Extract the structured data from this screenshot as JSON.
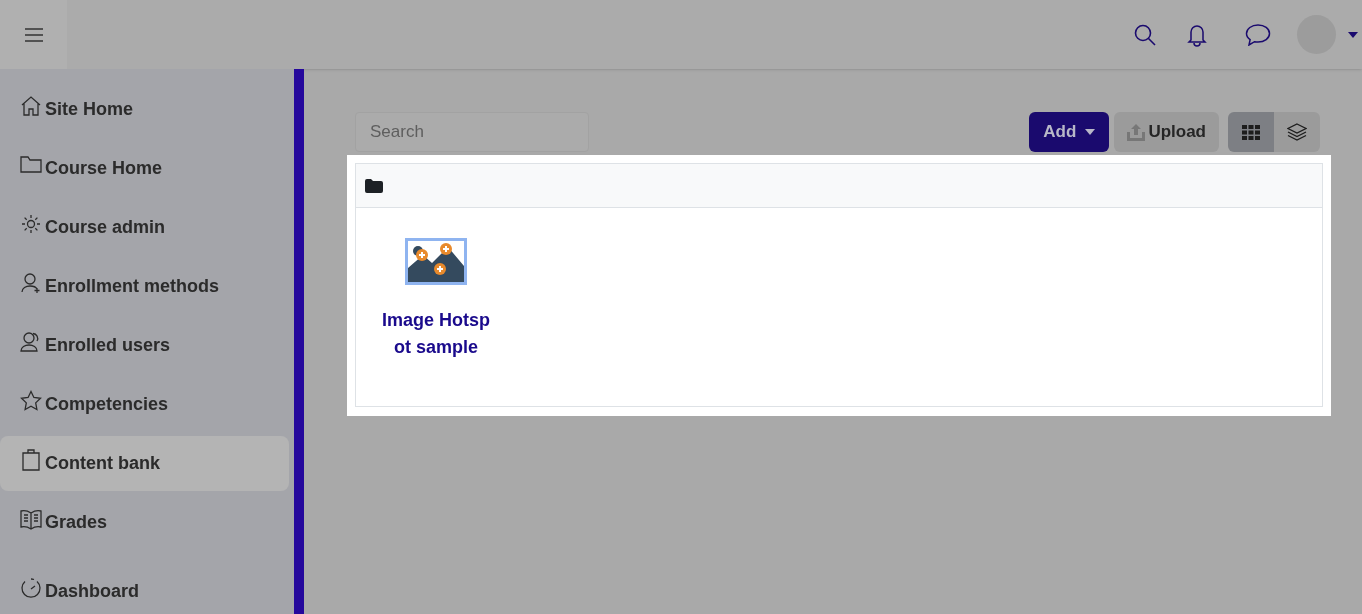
{
  "sidebar": {
    "items": [
      {
        "label": "Site Home",
        "selected": false
      },
      {
        "label": "Course Home",
        "selected": false
      },
      {
        "label": "Course admin",
        "selected": false
      },
      {
        "label": "Enrollment methods",
        "selected": false
      },
      {
        "label": "Enrolled users",
        "selected": false
      },
      {
        "label": "Competencies",
        "selected": false
      },
      {
        "label": "Content bank",
        "selected": true
      },
      {
        "label": "Grades",
        "selected": false
      },
      {
        "label": "Dashboard",
        "selected": false
      }
    ]
  },
  "toolbar": {
    "search": {
      "placeholder": "Search"
    },
    "add_button": "Add",
    "upload_button": "Upload",
    "view_buttons": [
      {
        "selected": true
      },
      {
        "selected": false
      }
    ]
  },
  "content": {
    "items": [
      {
        "title": "Image Hotspot sample"
      }
    ]
  }
}
